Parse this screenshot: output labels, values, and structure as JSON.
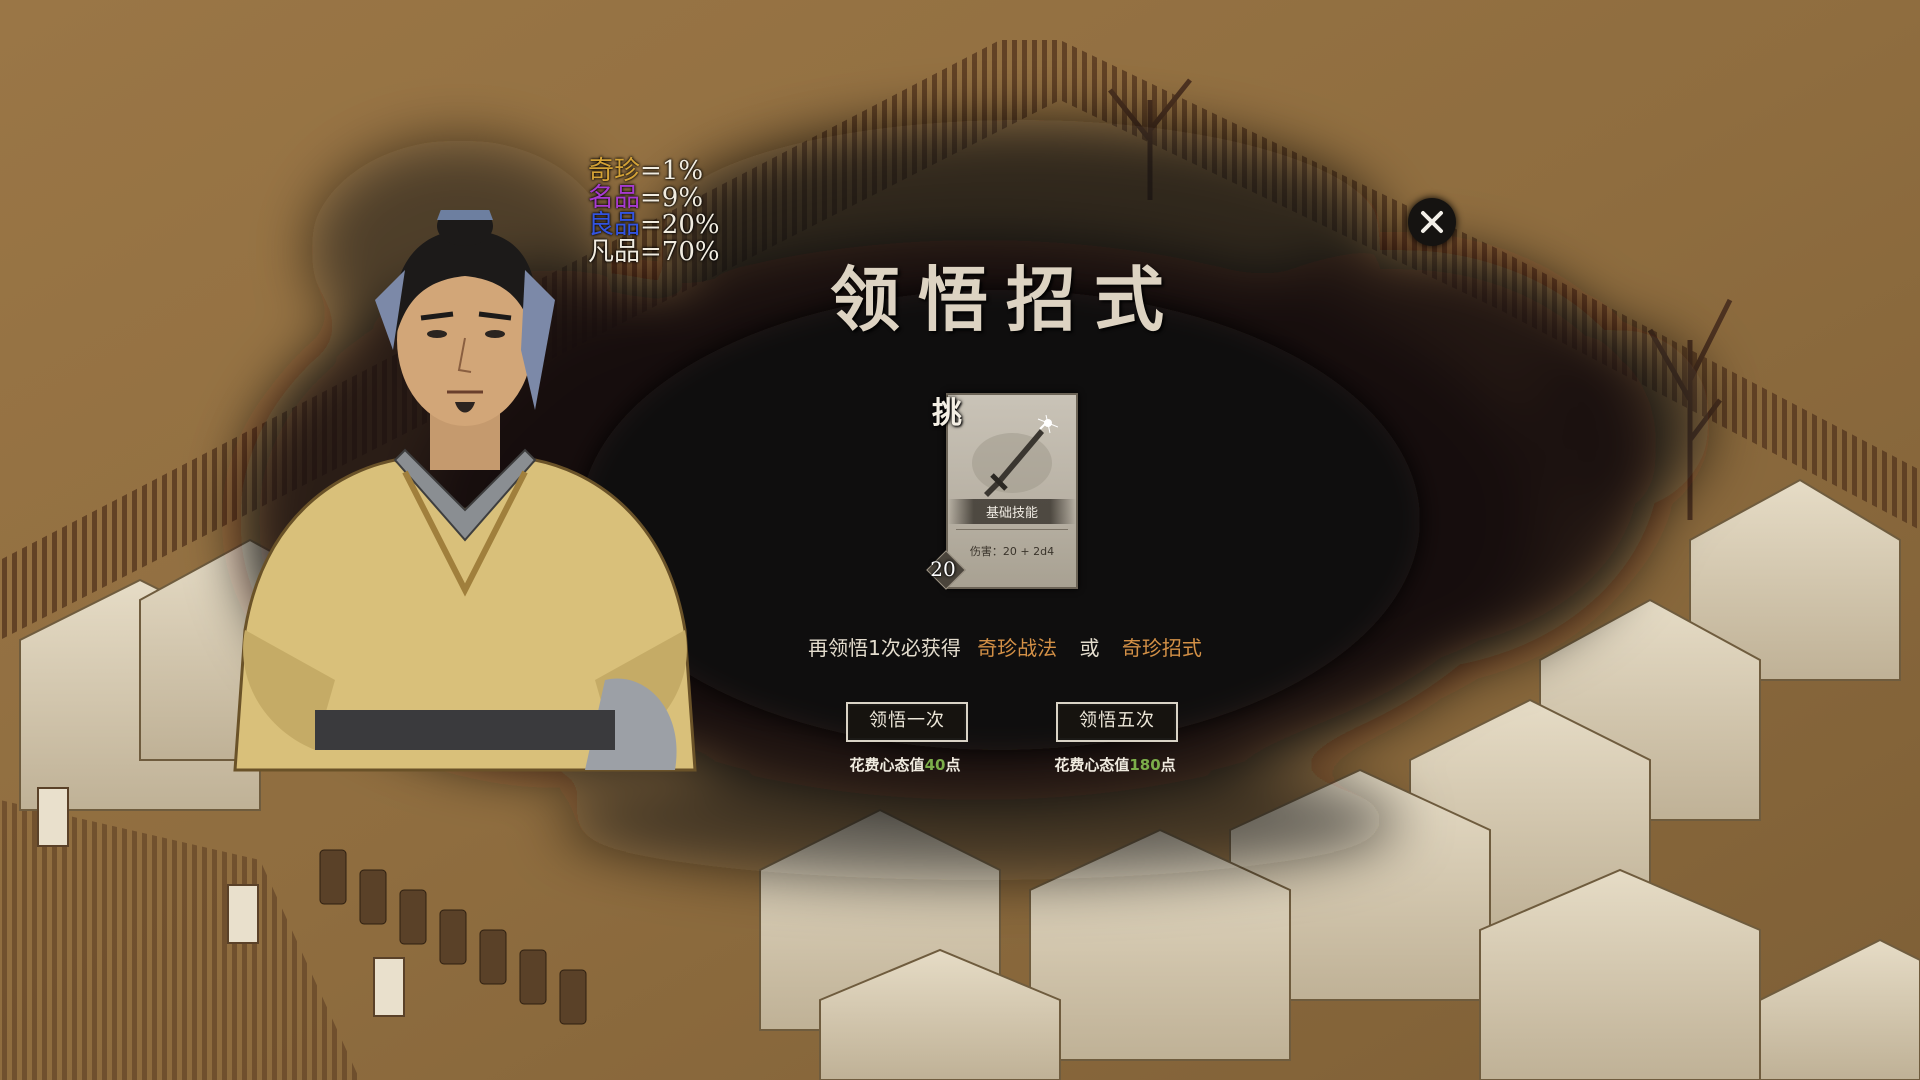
{
  "rates": [
    {
      "quality": "奇珍",
      "value": "=1%",
      "color": "#d4a236"
    },
    {
      "quality": "名品",
      "value": "=9%",
      "color": "#a83bd0"
    },
    {
      "quality": "良品",
      "value": "=20%",
      "color": "#3354e0"
    },
    {
      "quality": "凡品",
      "value": "=70%",
      "color": "#f1ece0"
    }
  ],
  "title": "领悟招式",
  "close_icon": "close-icon",
  "card": {
    "name": "挑",
    "type": "基础技能",
    "damage": "伤害：20 + 2d4",
    "cost": "20",
    "art_icon": "sword-icon"
  },
  "hint": {
    "prefix": "再领悟1次必获得",
    "reward_a": "奇珍战法",
    "or": "或",
    "reward_b": "奇珍招式",
    "highlight_color": "#d39046"
  },
  "buttons": {
    "once": {
      "label": "领悟一次",
      "cost_prefix": "花费心态值",
      "cost_value": "40",
      "cost_suffix": "点"
    },
    "five": {
      "label": "领悟五次",
      "cost_prefix": "花费心态值",
      "cost_value": "180",
      "cost_suffix": "点"
    }
  }
}
